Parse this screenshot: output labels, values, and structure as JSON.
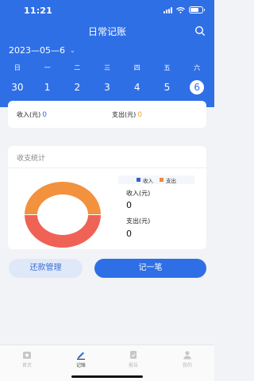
{
  "status_bar": {
    "time": "11:21"
  },
  "header": {
    "title": "日常记账",
    "date": "2023—05—6",
    "date_caret": "⌄"
  },
  "calendar": {
    "weekdays": [
      "日",
      "一",
      "二",
      "三",
      "四",
      "五",
      "六"
    ],
    "days": [
      "30",
      "1",
      "2",
      "3",
      "4",
      "5",
      "6"
    ],
    "selected_day": "6"
  },
  "summary": {
    "income_label": "收入(元)",
    "income_value": "0",
    "expense_label": "支出(元)",
    "expense_value": "0"
  },
  "stats": {
    "heading": "收支统计",
    "legend": {
      "income": "收入",
      "expense": "支出"
    },
    "income_label": "收入(元)",
    "income_value": "0",
    "expense_label": "支出(元)",
    "expense_value": "0"
  },
  "actions": {
    "repay": "还款管理",
    "record": "记一笔"
  },
  "tabbar": {
    "items": [
      "首页",
      "记账",
      "报告",
      "我的"
    ],
    "active_index": 1
  },
  "colors": {
    "primary": "#2f6fe6",
    "income": "#3a5fc8",
    "expense": "#f0873f",
    "donut_top": "#f2923e",
    "donut_bottom": "#ee6356"
  }
}
